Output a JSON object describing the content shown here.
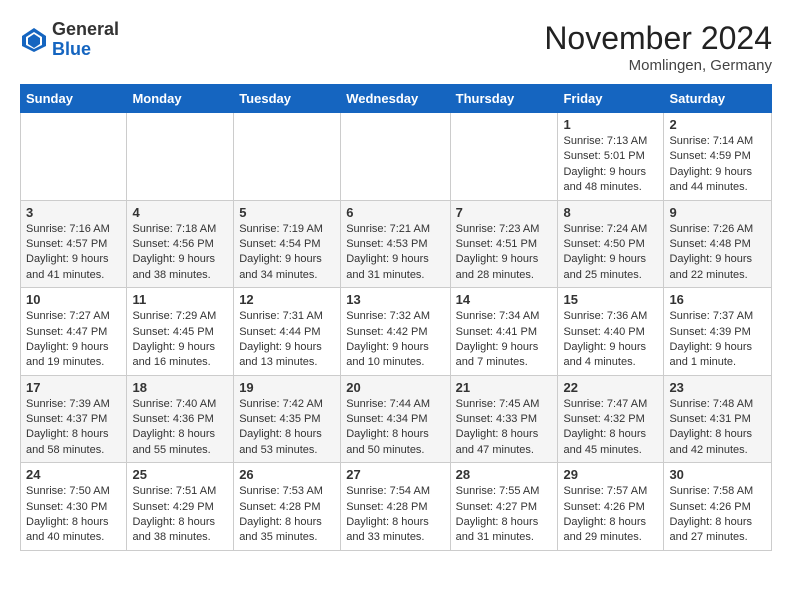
{
  "header": {
    "logo_general": "General",
    "logo_blue": "Blue",
    "month_title": "November 2024",
    "location": "Momlingen, Germany"
  },
  "weekdays": [
    "Sunday",
    "Monday",
    "Tuesday",
    "Wednesday",
    "Thursday",
    "Friday",
    "Saturday"
  ],
  "weeks": [
    [
      {
        "day": "",
        "info": ""
      },
      {
        "day": "",
        "info": ""
      },
      {
        "day": "",
        "info": ""
      },
      {
        "day": "",
        "info": ""
      },
      {
        "day": "",
        "info": ""
      },
      {
        "day": "1",
        "info": "Sunrise: 7:13 AM\nSunset: 5:01 PM\nDaylight: 9 hours and 48 minutes."
      },
      {
        "day": "2",
        "info": "Sunrise: 7:14 AM\nSunset: 4:59 PM\nDaylight: 9 hours and 44 minutes."
      }
    ],
    [
      {
        "day": "3",
        "info": "Sunrise: 7:16 AM\nSunset: 4:57 PM\nDaylight: 9 hours and 41 minutes."
      },
      {
        "day": "4",
        "info": "Sunrise: 7:18 AM\nSunset: 4:56 PM\nDaylight: 9 hours and 38 minutes."
      },
      {
        "day": "5",
        "info": "Sunrise: 7:19 AM\nSunset: 4:54 PM\nDaylight: 9 hours and 34 minutes."
      },
      {
        "day": "6",
        "info": "Sunrise: 7:21 AM\nSunset: 4:53 PM\nDaylight: 9 hours and 31 minutes."
      },
      {
        "day": "7",
        "info": "Sunrise: 7:23 AM\nSunset: 4:51 PM\nDaylight: 9 hours and 28 minutes."
      },
      {
        "day": "8",
        "info": "Sunrise: 7:24 AM\nSunset: 4:50 PM\nDaylight: 9 hours and 25 minutes."
      },
      {
        "day": "9",
        "info": "Sunrise: 7:26 AM\nSunset: 4:48 PM\nDaylight: 9 hours and 22 minutes."
      }
    ],
    [
      {
        "day": "10",
        "info": "Sunrise: 7:27 AM\nSunset: 4:47 PM\nDaylight: 9 hours and 19 minutes."
      },
      {
        "day": "11",
        "info": "Sunrise: 7:29 AM\nSunset: 4:45 PM\nDaylight: 9 hours and 16 minutes."
      },
      {
        "day": "12",
        "info": "Sunrise: 7:31 AM\nSunset: 4:44 PM\nDaylight: 9 hours and 13 minutes."
      },
      {
        "day": "13",
        "info": "Sunrise: 7:32 AM\nSunset: 4:42 PM\nDaylight: 9 hours and 10 minutes."
      },
      {
        "day": "14",
        "info": "Sunrise: 7:34 AM\nSunset: 4:41 PM\nDaylight: 9 hours and 7 minutes."
      },
      {
        "day": "15",
        "info": "Sunrise: 7:36 AM\nSunset: 4:40 PM\nDaylight: 9 hours and 4 minutes."
      },
      {
        "day": "16",
        "info": "Sunrise: 7:37 AM\nSunset: 4:39 PM\nDaylight: 9 hours and 1 minute."
      }
    ],
    [
      {
        "day": "17",
        "info": "Sunrise: 7:39 AM\nSunset: 4:37 PM\nDaylight: 8 hours and 58 minutes."
      },
      {
        "day": "18",
        "info": "Sunrise: 7:40 AM\nSunset: 4:36 PM\nDaylight: 8 hours and 55 minutes."
      },
      {
        "day": "19",
        "info": "Sunrise: 7:42 AM\nSunset: 4:35 PM\nDaylight: 8 hours and 53 minutes."
      },
      {
        "day": "20",
        "info": "Sunrise: 7:44 AM\nSunset: 4:34 PM\nDaylight: 8 hours and 50 minutes."
      },
      {
        "day": "21",
        "info": "Sunrise: 7:45 AM\nSunset: 4:33 PM\nDaylight: 8 hours and 47 minutes."
      },
      {
        "day": "22",
        "info": "Sunrise: 7:47 AM\nSunset: 4:32 PM\nDaylight: 8 hours and 45 minutes."
      },
      {
        "day": "23",
        "info": "Sunrise: 7:48 AM\nSunset: 4:31 PM\nDaylight: 8 hours and 42 minutes."
      }
    ],
    [
      {
        "day": "24",
        "info": "Sunrise: 7:50 AM\nSunset: 4:30 PM\nDaylight: 8 hours and 40 minutes."
      },
      {
        "day": "25",
        "info": "Sunrise: 7:51 AM\nSunset: 4:29 PM\nDaylight: 8 hours and 38 minutes."
      },
      {
        "day": "26",
        "info": "Sunrise: 7:53 AM\nSunset: 4:28 PM\nDaylight: 8 hours and 35 minutes."
      },
      {
        "day": "27",
        "info": "Sunrise: 7:54 AM\nSunset: 4:28 PM\nDaylight: 8 hours and 33 minutes."
      },
      {
        "day": "28",
        "info": "Sunrise: 7:55 AM\nSunset: 4:27 PM\nDaylight: 8 hours and 31 minutes."
      },
      {
        "day": "29",
        "info": "Sunrise: 7:57 AM\nSunset: 4:26 PM\nDaylight: 8 hours and 29 minutes."
      },
      {
        "day": "30",
        "info": "Sunrise: 7:58 AM\nSunset: 4:26 PM\nDaylight: 8 hours and 27 minutes."
      }
    ]
  ]
}
